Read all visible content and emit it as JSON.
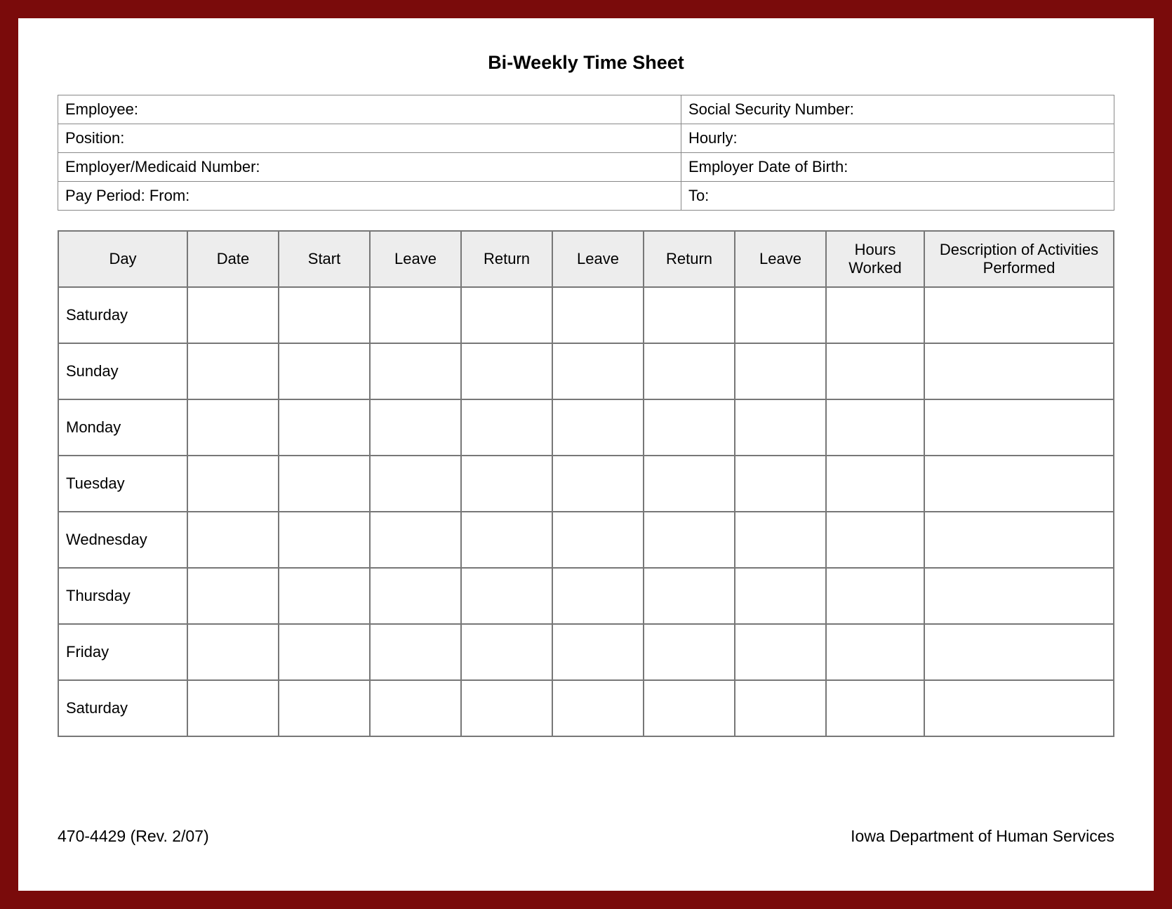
{
  "title": "Bi-Weekly Time Sheet",
  "info": {
    "rows": [
      {
        "left": "Employee:",
        "right": "Social Security Number:"
      },
      {
        "left": "Position:",
        "right": "Hourly:"
      },
      {
        "left": "Employer/Medicaid Number:",
        "right": "Employer Date of Birth:"
      },
      {
        "left": "Pay Period:  From:",
        "right": "To:"
      }
    ]
  },
  "timesheet": {
    "headers": [
      "Day",
      "Date",
      "Start",
      "Leave",
      "Return",
      "Leave",
      "Return",
      "Leave",
      "Hours Worked",
      "Description of Activities Performed"
    ],
    "days": [
      "Saturday",
      "Sunday",
      "Monday",
      "Tuesday",
      "Wednesday",
      "Thursday",
      "Friday",
      "Saturday"
    ]
  },
  "footer": {
    "form_number": "470-4429  (Rev. 2/07)",
    "agency": "Iowa Department of Human Services"
  }
}
